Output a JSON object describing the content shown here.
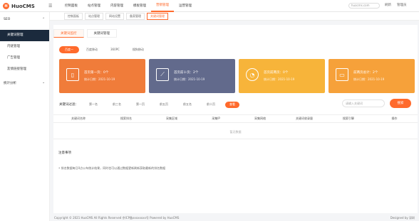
{
  "app": {
    "logo_text": "HuoCMS"
  },
  "topnav": [
    "控制面板",
    "站点管理",
    "内容管理",
    "模板管理",
    "营销管理",
    "运营管理"
  ],
  "topbar": {
    "search_placeholder": "huocms.com",
    "right": [
      "刷新",
      "管理员"
    ]
  },
  "sidebar": {
    "group1": "SEO",
    "items": [
      "关键词管理",
      "内链管理",
      "广告管理",
      "友情链接管理"
    ],
    "group2": "统计分析"
  },
  "tabs": [
    "控制面板",
    "站点管理",
    "网站设置",
    "备案管理",
    "关键词管理"
  ],
  "subtabs": [
    "关键词监控",
    "关键词管理"
  ],
  "pills": [
    "百度一",
    "百度移动",
    "360PC",
    "搜狗移动"
  ],
  "cards": [
    {
      "title": "首页第一页：0个",
      "date": "统计日期：2021-10-19",
      "color": "#f07c3a"
    },
    {
      "title": "首页前十页：2个",
      "date": "统计日期：2021-10-19",
      "color": "#626a8c"
    },
    {
      "title": "首页前两页：0个",
      "date": "统计日期：2021-10-19",
      "color": "#f7b43a"
    },
    {
      "title": "前两页总计：2个",
      "date": "统计日期：2021-10-19",
      "color": "#f6a13a"
    }
  ],
  "filter": {
    "label": "关键词过滤：",
    "chips": [
      "第一名",
      "前三名",
      "第一页",
      "前五页",
      "前五名",
      "前十页"
    ],
    "query_btn": "查看",
    "kw_placeholder": "请输入关键词",
    "search_btn": "搜索"
  },
  "table": {
    "headers": [
      "关键词名称",
      "搜索排名",
      "采集区域",
      "采集IP",
      "采集网络",
      "关键词收录量",
      "搜索引擎",
      "操作"
    ],
    "empty": "暂无数据"
  },
  "notice": {
    "title": "注意事项",
    "items": [
      "• 排名数据每日0点公布统计结果，同时也可以通过数据更新刷新获取最新的排名数据"
    ]
  },
  "footer": {
    "copyright": "Copyright © 2021 HuoCMS All Rights Reserved 京ICP备xxxxxxxx号 Powered by HuoCMS",
    "designed": "Designed by 深圳"
  }
}
